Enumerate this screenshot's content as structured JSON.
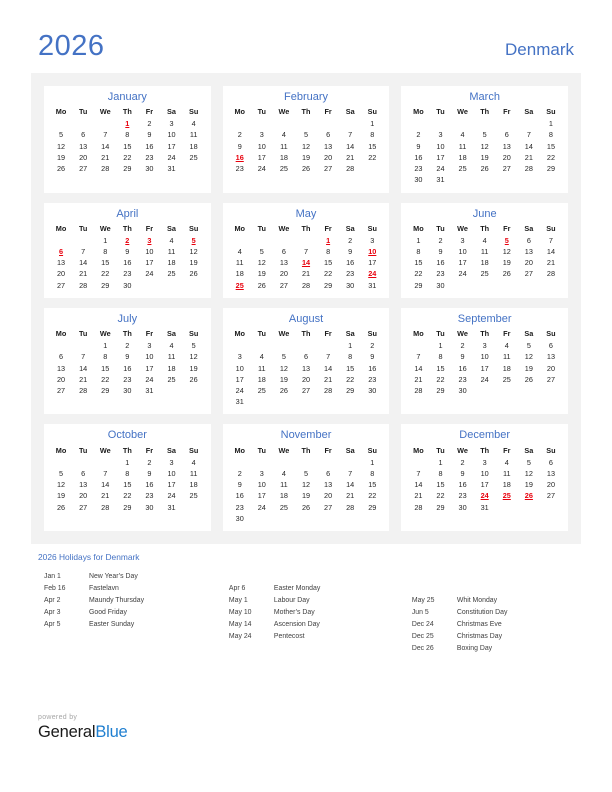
{
  "header": {
    "year": "2026",
    "country": "Denmark",
    "accent_color": "#4472c4",
    "holiday_color": "#e8000d"
  },
  "weekday_headers": [
    "Mo",
    "Tu",
    "We",
    "Th",
    "Fr",
    "Sa",
    "Su"
  ],
  "months": [
    {
      "name": "January",
      "weeks": [
        [
          "",
          "",
          "",
          "1",
          "2",
          "3",
          "4"
        ],
        [
          "5",
          "6",
          "7",
          "8",
          "9",
          "10",
          "11"
        ],
        [
          "12",
          "13",
          "14",
          "15",
          "16",
          "17",
          "18"
        ],
        [
          "19",
          "20",
          "21",
          "22",
          "23",
          "24",
          "25"
        ],
        [
          "26",
          "27",
          "28",
          "29",
          "30",
          "31",
          ""
        ]
      ],
      "holidays": [
        "1"
      ]
    },
    {
      "name": "February",
      "weeks": [
        [
          "",
          "",
          "",
          "",
          "",
          "",
          "1"
        ],
        [
          "2",
          "3",
          "4",
          "5",
          "6",
          "7",
          "8"
        ],
        [
          "9",
          "10",
          "11",
          "12",
          "13",
          "14",
          "15"
        ],
        [
          "16",
          "17",
          "18",
          "19",
          "20",
          "21",
          "22"
        ],
        [
          "23",
          "24",
          "25",
          "26",
          "27",
          "28",
          ""
        ]
      ],
      "holidays": [
        "16"
      ]
    },
    {
      "name": "March",
      "weeks": [
        [
          "",
          "",
          "",
          "",
          "",
          "",
          "1"
        ],
        [
          "2",
          "3",
          "4",
          "5",
          "6",
          "7",
          "8"
        ],
        [
          "9",
          "10",
          "11",
          "12",
          "13",
          "14",
          "15"
        ],
        [
          "16",
          "17",
          "18",
          "19",
          "20",
          "21",
          "22"
        ],
        [
          "23",
          "24",
          "25",
          "26",
          "27",
          "28",
          "29"
        ],
        [
          "30",
          "31",
          "",
          "",
          "",
          "",
          ""
        ]
      ],
      "holidays": []
    },
    {
      "name": "April",
      "weeks": [
        [
          "",
          "",
          "1",
          "2",
          "3",
          "4",
          "5"
        ],
        [
          "6",
          "7",
          "8",
          "9",
          "10",
          "11",
          "12"
        ],
        [
          "13",
          "14",
          "15",
          "16",
          "17",
          "18",
          "19"
        ],
        [
          "20",
          "21",
          "22",
          "23",
          "24",
          "25",
          "26"
        ],
        [
          "27",
          "28",
          "29",
          "30",
          "",
          "",
          ""
        ]
      ],
      "holidays": [
        "2",
        "3",
        "5",
        "6"
      ]
    },
    {
      "name": "May",
      "weeks": [
        [
          "",
          "",
          "",
          "",
          "1",
          "2",
          "3"
        ],
        [
          "4",
          "5",
          "6",
          "7",
          "8",
          "9",
          "10"
        ],
        [
          "11",
          "12",
          "13",
          "14",
          "15",
          "16",
          "17"
        ],
        [
          "18",
          "19",
          "20",
          "21",
          "22",
          "23",
          "24"
        ],
        [
          "25",
          "26",
          "27",
          "28",
          "29",
          "30",
          "31"
        ]
      ],
      "holidays": [
        "1",
        "10",
        "14",
        "24",
        "25"
      ]
    },
    {
      "name": "June",
      "weeks": [
        [
          "1",
          "2",
          "3",
          "4",
          "5",
          "6",
          "7"
        ],
        [
          "8",
          "9",
          "10",
          "11",
          "12",
          "13",
          "14"
        ],
        [
          "15",
          "16",
          "17",
          "18",
          "19",
          "20",
          "21"
        ],
        [
          "22",
          "23",
          "24",
          "25",
          "26",
          "27",
          "28"
        ],
        [
          "29",
          "30",
          "",
          "",
          "",
          "",
          ""
        ]
      ],
      "holidays": [
        "5"
      ]
    },
    {
      "name": "July",
      "weeks": [
        [
          "",
          "",
          "1",
          "2",
          "3",
          "4",
          "5"
        ],
        [
          "6",
          "7",
          "8",
          "9",
          "10",
          "11",
          "12"
        ],
        [
          "13",
          "14",
          "15",
          "16",
          "17",
          "18",
          "19"
        ],
        [
          "20",
          "21",
          "22",
          "23",
          "24",
          "25",
          "26"
        ],
        [
          "27",
          "28",
          "29",
          "30",
          "31",
          "",
          ""
        ]
      ],
      "holidays": []
    },
    {
      "name": "August",
      "weeks": [
        [
          "",
          "",
          "",
          "",
          "",
          "1",
          "2"
        ],
        [
          "3",
          "4",
          "5",
          "6",
          "7",
          "8",
          "9"
        ],
        [
          "10",
          "11",
          "12",
          "13",
          "14",
          "15",
          "16"
        ],
        [
          "17",
          "18",
          "19",
          "20",
          "21",
          "22",
          "23"
        ],
        [
          "24",
          "25",
          "26",
          "27",
          "28",
          "29",
          "30"
        ],
        [
          "31",
          "",
          "",
          "",
          "",
          "",
          ""
        ]
      ],
      "holidays": []
    },
    {
      "name": "September",
      "weeks": [
        [
          "",
          "1",
          "2",
          "3",
          "4",
          "5",
          "6"
        ],
        [
          "7",
          "8",
          "9",
          "10",
          "11",
          "12",
          "13"
        ],
        [
          "14",
          "15",
          "16",
          "17",
          "18",
          "19",
          "20"
        ],
        [
          "21",
          "22",
          "23",
          "24",
          "25",
          "26",
          "27"
        ],
        [
          "28",
          "29",
          "30",
          "",
          "",
          "",
          ""
        ]
      ],
      "holidays": []
    },
    {
      "name": "October",
      "weeks": [
        [
          "",
          "",
          "",
          "1",
          "2",
          "3",
          "4"
        ],
        [
          "5",
          "6",
          "7",
          "8",
          "9",
          "10",
          "11"
        ],
        [
          "12",
          "13",
          "14",
          "15",
          "16",
          "17",
          "18"
        ],
        [
          "19",
          "20",
          "21",
          "22",
          "23",
          "24",
          "25"
        ],
        [
          "26",
          "27",
          "28",
          "29",
          "30",
          "31",
          ""
        ]
      ],
      "holidays": []
    },
    {
      "name": "November",
      "weeks": [
        [
          "",
          "",
          "",
          "",
          "",
          "",
          "1"
        ],
        [
          "2",
          "3",
          "4",
          "5",
          "6",
          "7",
          "8"
        ],
        [
          "9",
          "10",
          "11",
          "12",
          "13",
          "14",
          "15"
        ],
        [
          "16",
          "17",
          "18",
          "19",
          "20",
          "21",
          "22"
        ],
        [
          "23",
          "24",
          "25",
          "26",
          "27",
          "28",
          "29"
        ],
        [
          "30",
          "",
          "",
          "",
          "",
          "",
          ""
        ]
      ],
      "holidays": []
    },
    {
      "name": "December",
      "weeks": [
        [
          "",
          "1",
          "2",
          "3",
          "4",
          "5",
          "6"
        ],
        [
          "7",
          "8",
          "9",
          "10",
          "11",
          "12",
          "13"
        ],
        [
          "14",
          "15",
          "16",
          "17",
          "18",
          "19",
          "20"
        ],
        [
          "21",
          "22",
          "23",
          "24",
          "25",
          "26",
          "27"
        ],
        [
          "28",
          "29",
          "30",
          "31",
          "",
          "",
          ""
        ]
      ],
      "holidays": [
        "24",
        "25",
        "26"
      ]
    }
  ],
  "holidays_legend": {
    "heading": "2026 Holidays for Denmark",
    "columns": [
      {
        "offset": 0,
        "entries": [
          {
            "date": "Jan 1",
            "name": "New Year’s Day"
          },
          {
            "date": "Feb 16",
            "name": "Fastelavn"
          },
          {
            "date": "Apr 2",
            "name": "Maundy Thursday"
          },
          {
            "date": "Apr 3",
            "name": "Good Friday"
          },
          {
            "date": "Apr 5",
            "name": "Easter Sunday"
          }
        ]
      },
      {
        "offset": 1,
        "entries": [
          {
            "date": "Apr 6",
            "name": "Easter Monday"
          },
          {
            "date": "May 1",
            "name": "Labour Day"
          },
          {
            "date": "May 10",
            "name": "Mother’s Day"
          },
          {
            "date": "May 14",
            "name": "Ascension Day"
          },
          {
            "date": "May 24",
            "name": "Pentecost"
          }
        ]
      },
      {
        "offset": 2,
        "entries": [
          {
            "date": "May 25",
            "name": "Whit Monday"
          },
          {
            "date": "Jun 5",
            "name": "Constitution Day"
          },
          {
            "date": "Dec 24",
            "name": "Christmas Eve"
          },
          {
            "date": "Dec 25",
            "name": "Christmas Day"
          },
          {
            "date": "Dec 26",
            "name": "Boxing Day"
          }
        ]
      }
    ]
  },
  "footer": {
    "powered_by": "powered by",
    "brand_first": "General",
    "brand_second": "Blue"
  }
}
